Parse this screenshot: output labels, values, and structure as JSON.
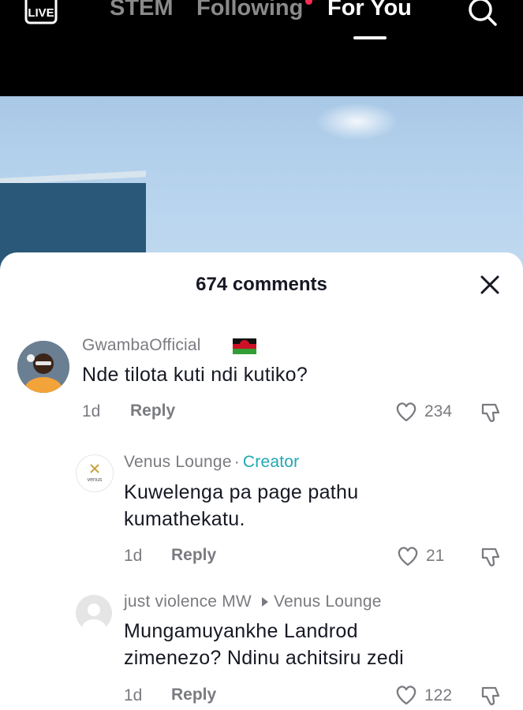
{
  "nav": {
    "live_label": "LIVE",
    "tabs": [
      {
        "label": "STEM"
      },
      {
        "label": "Following"
      },
      {
        "label": "For You"
      }
    ]
  },
  "comments_sheet": {
    "title": "674 comments",
    "comments": [
      {
        "username": "GwambaOfficial",
        "flag": "Malawi flag",
        "text": "Nde tilota kuti ndi kutiko?",
        "time": "1d",
        "reply_label": "Reply",
        "likes": "234"
      },
      {
        "username": "Venus Lounge",
        "separator": "·",
        "badge": "Creator",
        "avatar_text": "venus",
        "text_lines": [
          "Kuwelenga pa page pathu",
          "kumathekatu."
        ],
        "time": "1d",
        "reply_label": "Reply",
        "likes": "21"
      },
      {
        "username": "just violence MW",
        "reply_to": "Venus Lounge",
        "text_lines": [
          "Mungamuyankhe Landrod",
          "zimenezo? Ndinu achitsiru zedi"
        ],
        "time": "1d",
        "reply_label": "Reply",
        "likes": "122"
      }
    ]
  },
  "colors": {
    "creator_badge": "#20a8b4",
    "active_tab": "#ffffff",
    "inactive_tab": "#8a8a8a",
    "notification_dot": "#fe2c55"
  },
  "icons": [
    "live-icon",
    "search-icon",
    "close-icon",
    "heart-icon",
    "dislike-icon",
    "default-avatar-icon"
  ]
}
